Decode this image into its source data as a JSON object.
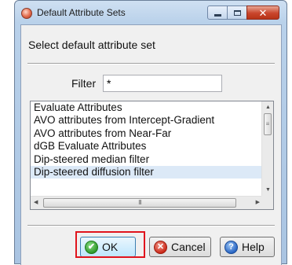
{
  "window": {
    "title": "Default Attribute Sets",
    "close_glyph": "✕"
  },
  "dialog": {
    "heading": "Select default attribute set",
    "filter_label": "Filter",
    "filter_value": "*"
  },
  "list": {
    "items": [
      "Evaluate Attributes",
      "AVO attributes from Intercept-Gradient",
      "AVO attributes from Near-Far",
      "dGB Evaluate Attributes",
      "Dip-steered median filter",
      "Dip-steered diffusion filter"
    ],
    "selected_item": "Dip-steered diffusion filter",
    "scroll_thumb_grip": "≡",
    "hscroll_thumb_grip": "III"
  },
  "buttons": {
    "ok": "OK",
    "cancel": "Cancel",
    "help": "Help",
    "ok_icon_glyph": "✔",
    "cancel_icon_glyph": "✕",
    "help_icon_glyph": "?"
  },
  "icons": {
    "app": "app-icon",
    "minimize": "minimize-icon",
    "maximize": "maximize-icon",
    "close": "close-icon",
    "ok": "checkmark-icon",
    "cancel": "cancel-icon",
    "help": "help-icon"
  },
  "colors": {
    "titlebar": "#b9d1ea",
    "close_button": "#c9452c",
    "selection": "#dce9f7",
    "highlight_box": "#e0141d"
  }
}
